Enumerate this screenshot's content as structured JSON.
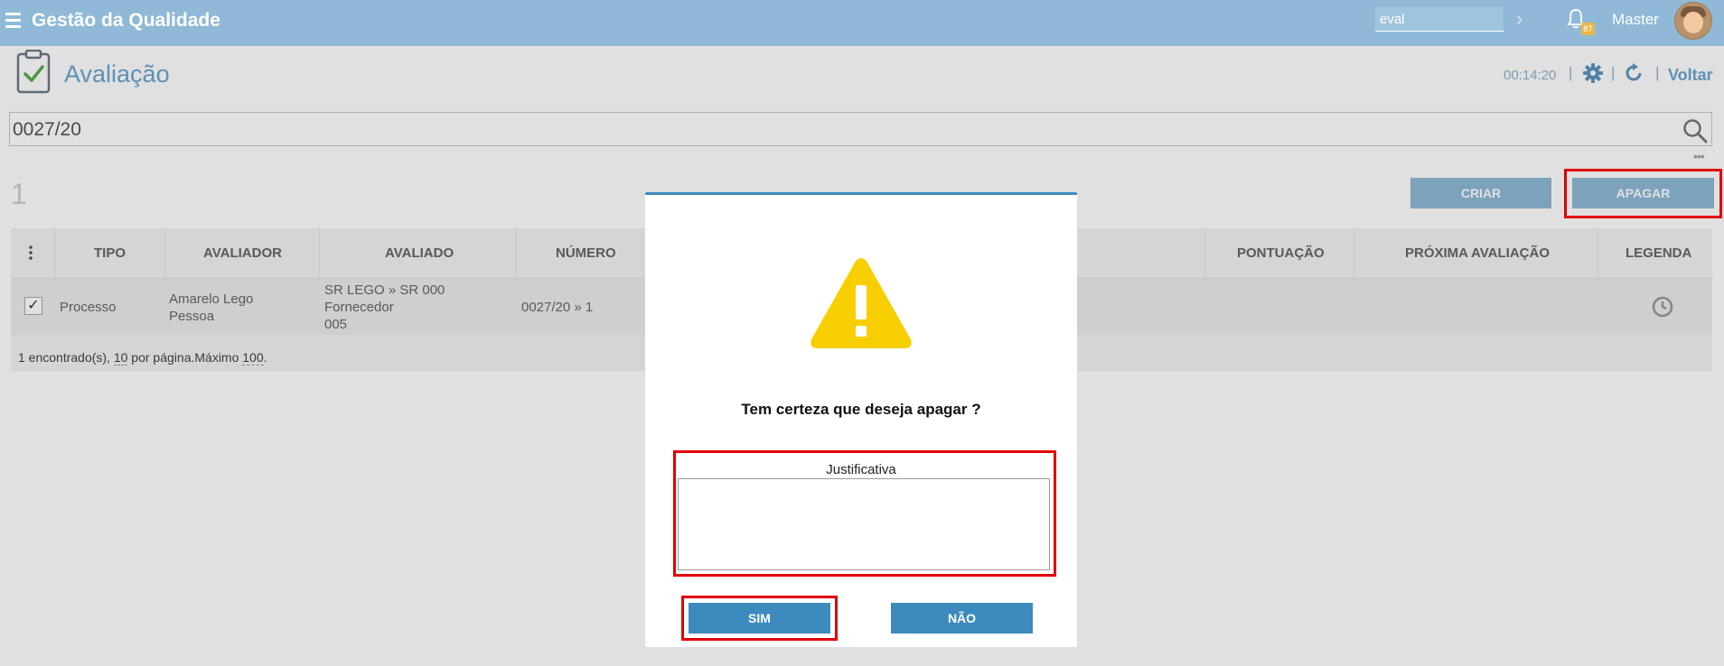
{
  "header": {
    "app_title": "Gestão da Qualidade",
    "search_value": "eval",
    "notification_count": "87",
    "user_name": "Master"
  },
  "page": {
    "title": "Avaliação",
    "timer": "00:14:20",
    "separator": "|",
    "back_label": "Voltar"
  },
  "search": {
    "value": "0027/20"
  },
  "results": {
    "count": "1"
  },
  "actions": {
    "create_label": "CRIAR",
    "delete_label": "APAGAR"
  },
  "table": {
    "menu_icon": "kebab-icon",
    "columns": [
      "TIPO",
      "AVALIADOR",
      "AVALIADO",
      "NÚMERO",
      "PONTUAÇÃO",
      "PRÓXIMA AVALIAÇÃO",
      "LEGENDA"
    ],
    "row": {
      "checked": "✓",
      "tipo": "Processo",
      "avaliador_line1": "Amarelo Lego",
      "avaliador_line2": "Pessoa",
      "avaliado_line1": "SR LEGO » SR 000",
      "avaliado_line2": "Fornecedor",
      "avaliado_line3": "005",
      "numero": "0027/20 » 1",
      "pontuacao": "",
      "proxima": "",
      "legenda_icon": "clock-icon"
    },
    "footer": {
      "found": "1 encontrado(s), ",
      "per_page": "10",
      "per_page_text": " por página.Máximo ",
      "max": "100",
      "end": "."
    }
  },
  "dialog": {
    "icon": "warning-icon",
    "message": "Tem certeza que deseja apagar ?",
    "justification_label": "Justificativa",
    "justification_value": "",
    "yes_label": "SIM",
    "no_label": "NÃO"
  },
  "colors": {
    "topbar": "#8fb9d6",
    "accent": "#3d8bbd",
    "warning": "#f5c800",
    "highlight": "#e00000"
  }
}
